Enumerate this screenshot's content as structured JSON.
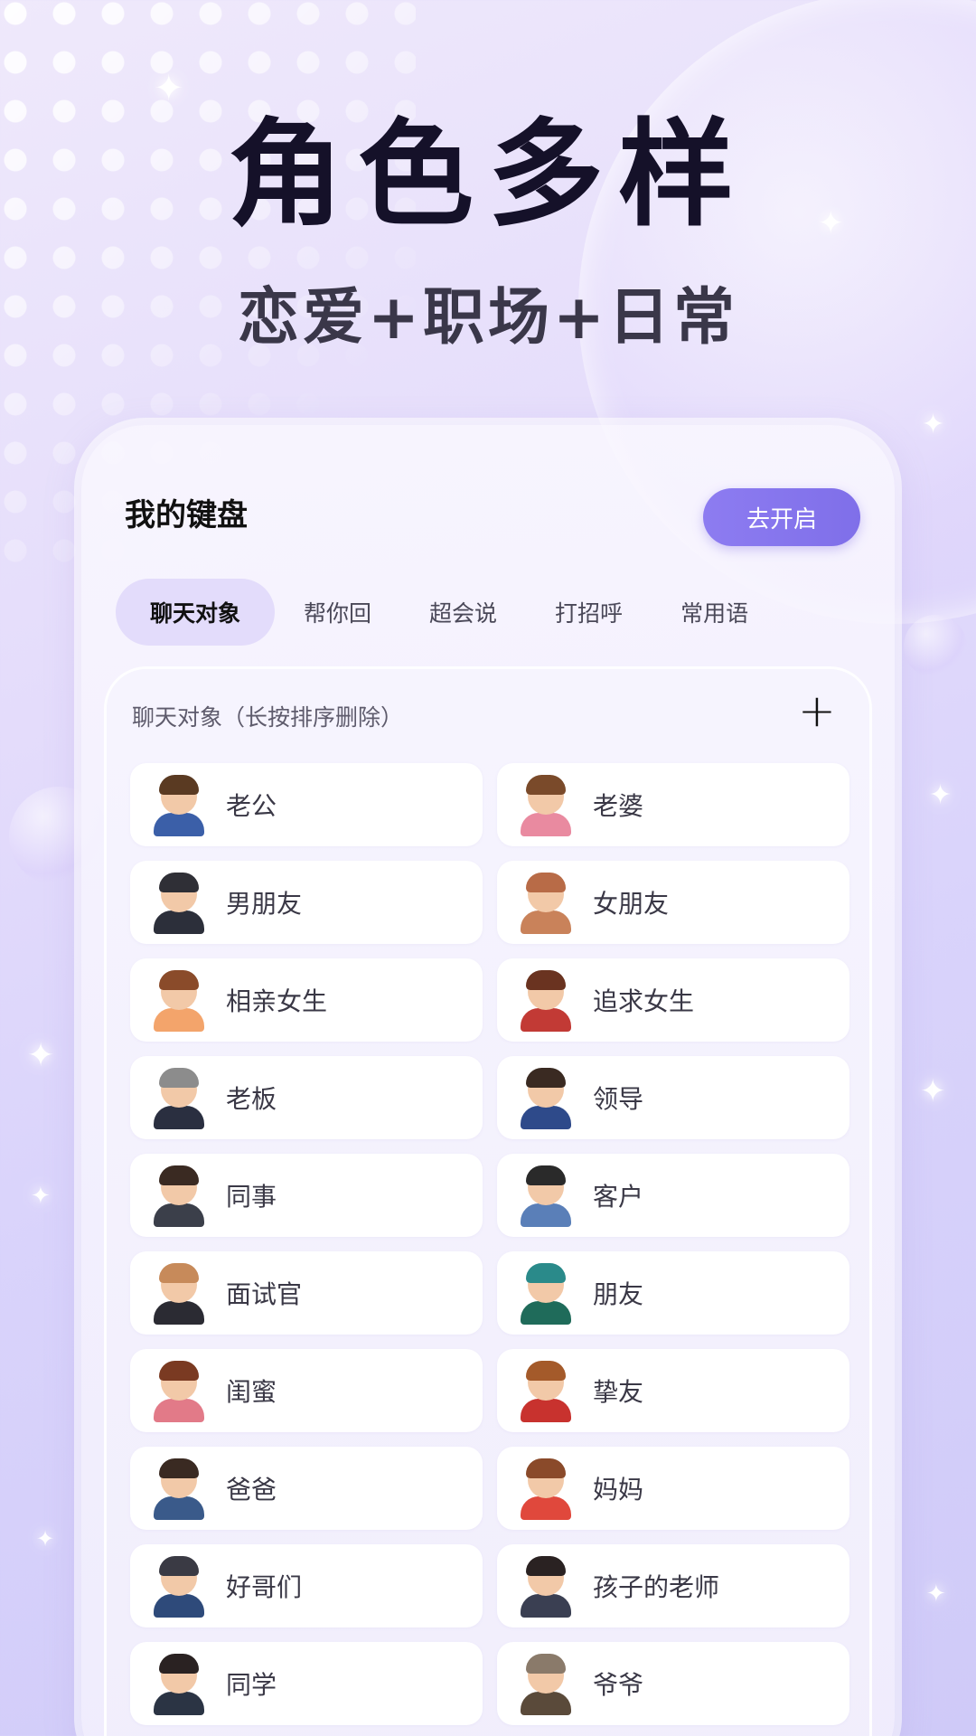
{
  "hero": {
    "title": "角色多样",
    "subtitle": "恋爱+职场+日常"
  },
  "keyboard": {
    "title": "我的键盘",
    "open_button": "去开启"
  },
  "tabs": [
    {
      "label": "聊天对象",
      "active": true
    },
    {
      "label": "帮你回",
      "active": false
    },
    {
      "label": "超会说",
      "active": false
    },
    {
      "label": "打招呼",
      "active": false
    },
    {
      "label": "常用语",
      "active": false
    }
  ],
  "panel": {
    "title": "聊天对象（长按排序删除）",
    "add_icon": "plus-icon"
  },
  "contacts": [
    {
      "label": "老公",
      "hair": "#5a3a22",
      "body": "#3b5fa8"
    },
    {
      "label": "老婆",
      "hair": "#7a4a2a",
      "body": "#e98aa0"
    },
    {
      "label": "男朋友",
      "hair": "#2f2f36",
      "body": "#2c2f3a"
    },
    {
      "label": "女朋友",
      "hair": "#b86b47",
      "body": "#c9825a"
    },
    {
      "label": "相亲女生",
      "hair": "#8a4b2a",
      "body": "#f3a46b"
    },
    {
      "label": "追求女生",
      "hair": "#6a3320",
      "body": "#c23a35"
    },
    {
      "label": "老板",
      "hair": "#8c8c8c",
      "body": "#2a2f40"
    },
    {
      "label": "领导",
      "hair": "#3a2a22",
      "body": "#2e4a8a"
    },
    {
      "label": "同事",
      "hair": "#3a2a22",
      "body": "#3b3f4a"
    },
    {
      "label": "客户",
      "hair": "#2a2a2a",
      "body": "#5a7fb8"
    },
    {
      "label": "面试官",
      "hair": "#c78a5a",
      "body": "#2b2b33"
    },
    {
      "label": "朋友",
      "hair": "#2a8a8a",
      "body": "#1f6b5a"
    },
    {
      "label": "闺蜜",
      "hair": "#7a3a22",
      "body": "#e27a88"
    },
    {
      "label": "挚友",
      "hair": "#a45a2a",
      "body": "#c8322e"
    },
    {
      "label": "爸爸",
      "hair": "#3a2a22",
      "body": "#3a5a8a"
    },
    {
      "label": "妈妈",
      "hair": "#8a4a2a",
      "body": "#e0483c"
    },
    {
      "label": "好哥们",
      "hair": "#3a3a44",
      "body": "#2e4a7a"
    },
    {
      "label": "孩子的老师",
      "hair": "#2a2222",
      "body": "#3a3f52"
    },
    {
      "label": "同学",
      "hair": "#2a2222",
      "body": "#2b3444"
    },
    {
      "label": "爷爷",
      "hair": "#8a7a6a",
      "body": "#5a4a3a"
    }
  ],
  "colors": {
    "accent": "#8d7cf1",
    "active_tab_bg": "#e3dcfb",
    "headline": "#151129"
  }
}
